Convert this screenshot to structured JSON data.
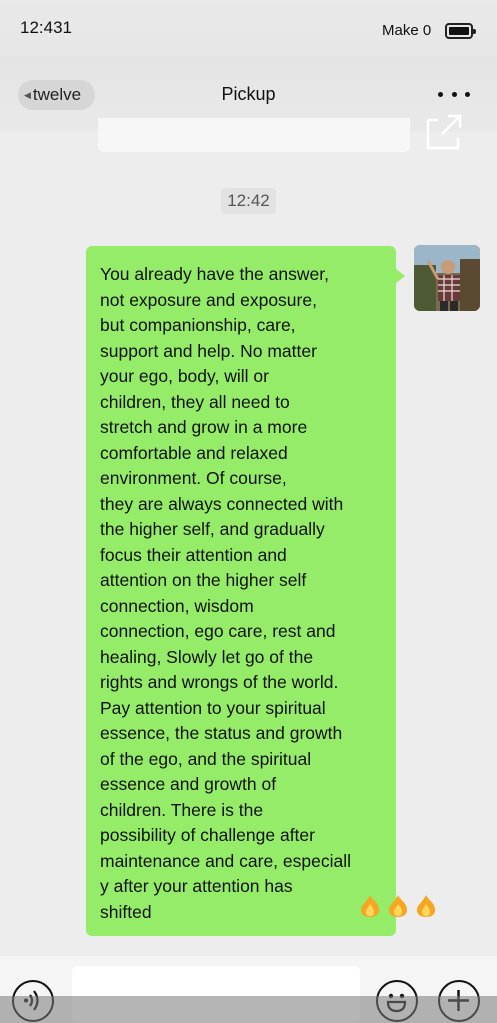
{
  "status_bar": {
    "time": "12:431",
    "carrier": "Make 0"
  },
  "header": {
    "back_label": "twelve",
    "title": "Pickup"
  },
  "conversation": {
    "timestamp": "12:42",
    "message_lines": [
      "You already have the answer,",
      "not exposure and exposure,",
      "but companionship, care,",
      "support and help. No matter",
      "your ego, body, will or",
      "children, they all need to",
      "stretch and grow in a more",
      "comfortable and relaxed",
      "environment. Of course,",
      "they are always connected with",
      "the higher self, and gradually",
      "focus their attention and",
      "attention on the higher self",
      "connection, wisdom",
      "connection, ego care, rest and",
      "healing, Slowly let go of the",
      "rights and wrongs of the world.",
      "Pay attention to your spiritual",
      "essence, the status and growth",
      "of the ego, and the spiritual",
      "essence and growth of",
      "children. There is the",
      "possibility of challenge after",
      "maintenance and care, especiall",
      "y after your attention has",
      "shifted"
    ],
    "emoji": [
      "fire-icon",
      "fire-icon",
      "fire-icon"
    ]
  },
  "colors": {
    "bubble": "#95ec69",
    "background": "#ededed"
  },
  "icons": [
    "more-icon",
    "share-icon",
    "voice-icon",
    "emoji-icon",
    "plus-icon"
  ]
}
